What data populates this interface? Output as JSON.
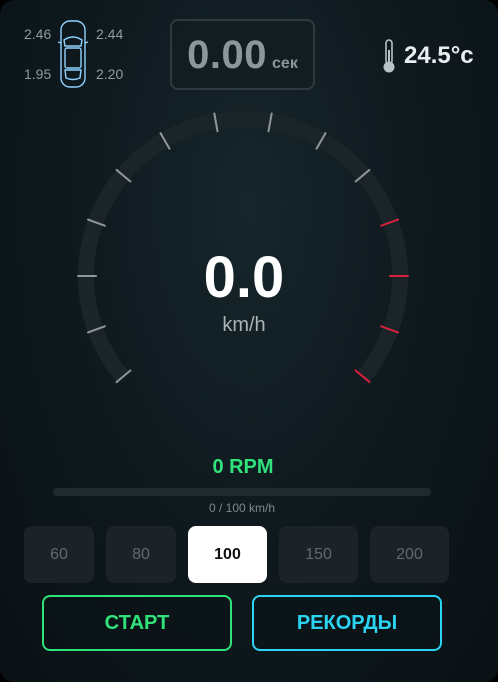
{
  "tires": {
    "front_left": "2.46",
    "front_right": "2.44",
    "rear_left": "1.95",
    "rear_right": "2.20",
    "icon": "car-top-view-icon"
  },
  "timer": {
    "value": "0.00",
    "unit": "сек"
  },
  "temperature": {
    "value": "24.5°c",
    "icon": "thermometer-icon"
  },
  "gauge": {
    "speed": "0.0",
    "unit": "km/h",
    "needle_level": 0
  },
  "rpm": {
    "label": "0 RPM"
  },
  "progress": {
    "label": "0 / 100 km/h",
    "fraction": 0
  },
  "targets": {
    "options": [
      "60",
      "80",
      "100",
      "150",
      "200"
    ],
    "selected": "100"
  },
  "buttons": {
    "start": "СТАРТ",
    "records": "РЕКОРДЫ"
  },
  "colors": {
    "accent_green": "#2fe37a",
    "accent_cyan": "#2bd4f2",
    "redline": "#d8203d",
    "tick_gray": "#8e979b"
  }
}
